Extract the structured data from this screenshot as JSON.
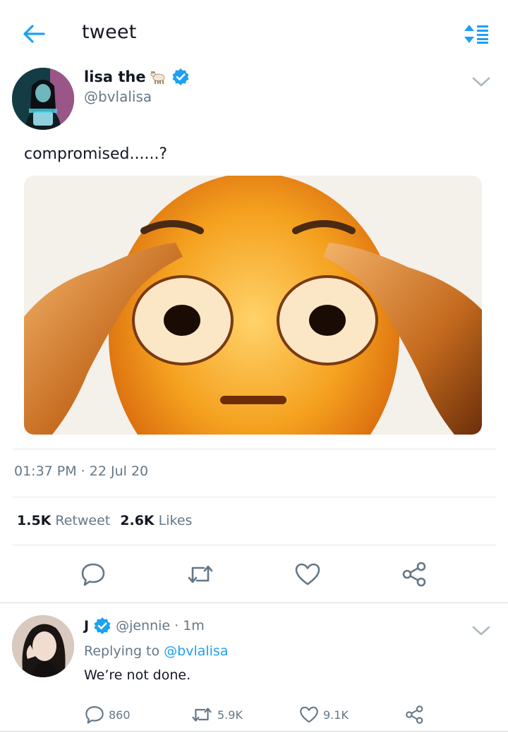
{
  "header": {
    "title": "tweet"
  },
  "tweet": {
    "author_name": "lisa the",
    "author_handle": "@bvlalisa",
    "text": "compromised......?",
    "timestamp": "01:37 PM · 22 Jul 20",
    "retweets_count": "1.5K",
    "retweets_label": "Retweet",
    "likes_count": "2.6K",
    "likes_label": "Likes"
  },
  "reply": {
    "author_name": "J",
    "author_handle": "@jennie",
    "time": "· 1m",
    "replying_prefix": "Replying to",
    "replying_to": "@bvlalisa",
    "text": "We’re not done.",
    "reply_count": "860",
    "retweet_count": "5.9K",
    "like_count": "9.1K"
  },
  "colors": {
    "accent": "#1da1f2",
    "muted": "#657786",
    "text": "#141823"
  },
  "icons": {
    "back": "arrow-left-icon",
    "sort": "sort-icon",
    "verified": "verified-badge-icon",
    "goat_emoji": "goat-emoji-icon",
    "caret": "chevron-down-icon",
    "reply": "reply-icon",
    "retweet": "retweet-icon",
    "like": "heart-icon",
    "share": "share-icon"
  }
}
